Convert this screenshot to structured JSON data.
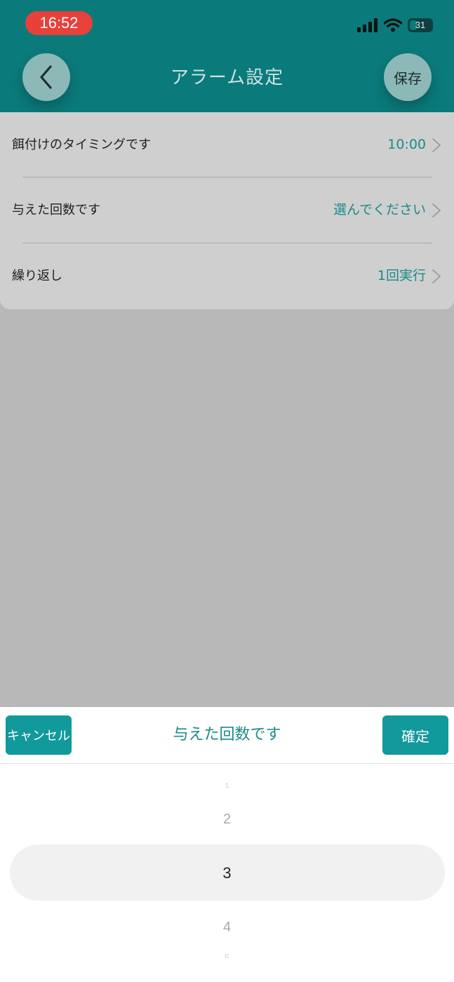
{
  "status_bar": {
    "time": "16:52",
    "battery": "31",
    "icons": [
      "signal-icon",
      "wifi-icon",
      "battery-icon"
    ]
  },
  "header": {
    "title": "アラーム設定",
    "save_label": "保存",
    "back_icon": "chevron-left-icon"
  },
  "settings": {
    "feeding_time": {
      "label": "餌付けのタイミングです",
      "value": "10:00"
    },
    "feed_count": {
      "label": "与えた回数です",
      "value": "選んでください"
    },
    "repeat": {
      "label": "繰り返し",
      "value": "1回実行"
    }
  },
  "picker_sheet": {
    "cancel_label": "キャンセル",
    "title": "与えた回数です",
    "confirm_label": "確定",
    "items": [
      "1",
      "2",
      "3",
      "4",
      "5"
    ],
    "selected": "3"
  },
  "colors": {
    "header": "#0b7a7a",
    "accent": "#11999b",
    "time_pill": "#e8403a",
    "overlay": "#b8b8b8"
  }
}
